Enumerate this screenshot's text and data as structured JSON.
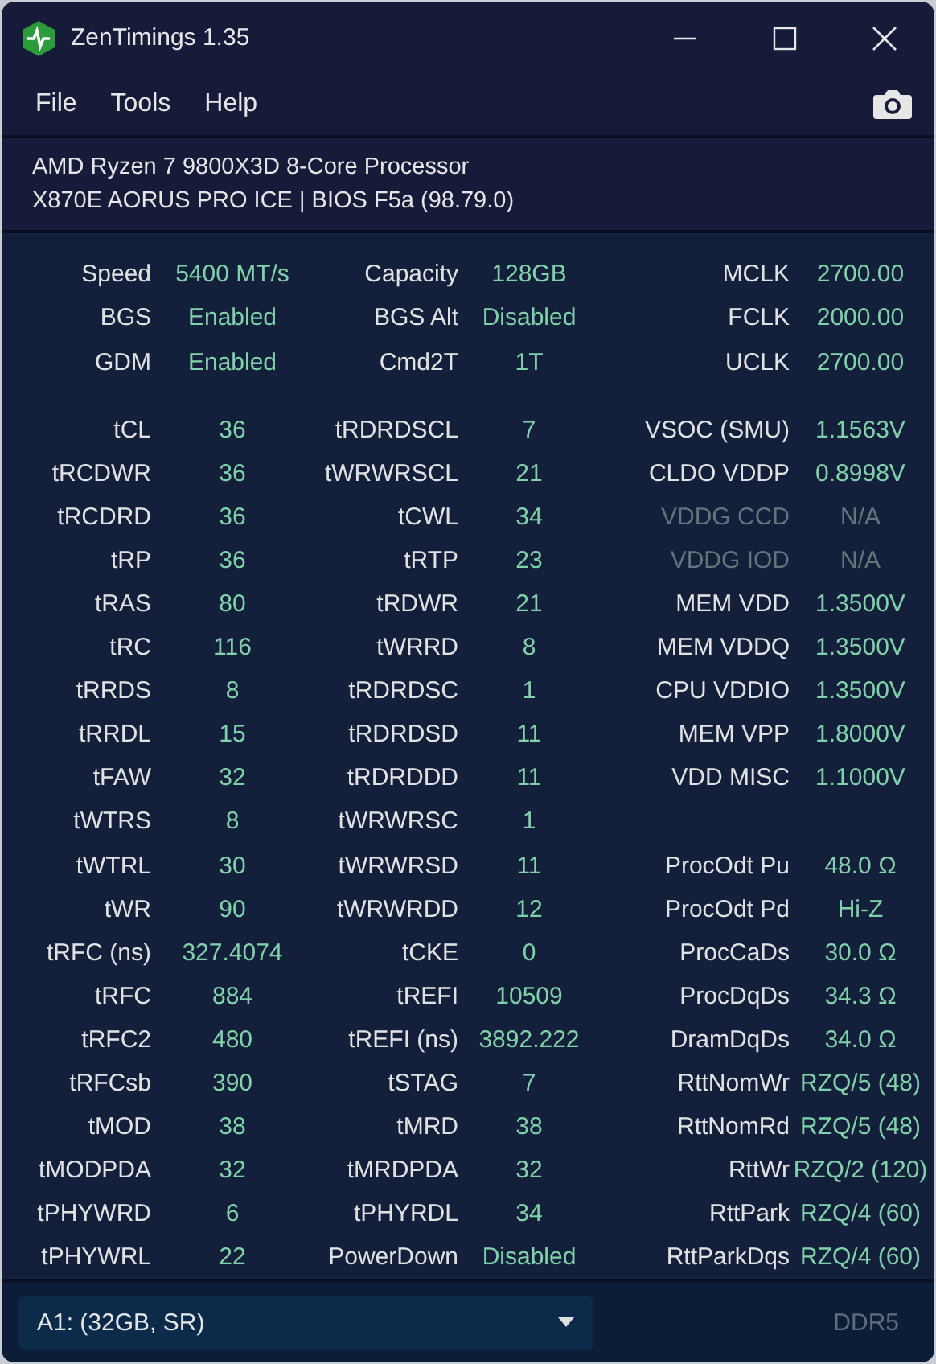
{
  "window": {
    "title": "ZenTimings 1.35"
  },
  "menu": [
    "File",
    "Tools",
    "Help"
  ],
  "system": {
    "cpu": "AMD Ryzen 7 9800X3D 8-Core Processor",
    "board": "X870E AORUS PRO ICE | BIOS F5a (98.79.0)"
  },
  "summary": [
    [
      {
        "label": "Speed",
        "value": "5400 MT/s",
        "disabled": false
      },
      {
        "label": "Capacity",
        "value": "128GB",
        "disabled": false
      },
      {
        "label": "MCLK",
        "value": "2700.00",
        "disabled": false
      }
    ],
    [
      {
        "label": "BGS",
        "value": "Enabled",
        "disabled": false
      },
      {
        "label": "BGS Alt",
        "value": "Disabled",
        "disabled": false
      },
      {
        "label": "FCLK",
        "value": "2000.00",
        "disabled": false
      }
    ],
    [
      {
        "label": "GDM",
        "value": "Enabled",
        "disabled": false
      },
      {
        "label": "Cmd2T",
        "value": "1T",
        "disabled": false
      },
      {
        "label": "UCLK",
        "value": "2700.00",
        "disabled": false
      }
    ]
  ],
  "timings": [
    [
      {
        "label": "tCL",
        "value": "36",
        "disabled": false
      },
      {
        "label": "tRDRDSCL",
        "value": "7",
        "disabled": false
      },
      {
        "label": "VSOC (SMU)",
        "value": "1.1563V",
        "disabled": false
      }
    ],
    [
      {
        "label": "tRCDWR",
        "value": "36",
        "disabled": false
      },
      {
        "label": "tWRWRSCL",
        "value": "21",
        "disabled": false
      },
      {
        "label": "CLDO VDDP",
        "value": "0.8998V",
        "disabled": false
      }
    ],
    [
      {
        "label": "tRCDRD",
        "value": "36",
        "disabled": false
      },
      {
        "label": "tCWL",
        "value": "34",
        "disabled": false
      },
      {
        "label": "VDDG CCD",
        "value": "N/A",
        "disabled": true
      }
    ],
    [
      {
        "label": "tRP",
        "value": "36",
        "disabled": false
      },
      {
        "label": "tRTP",
        "value": "23",
        "disabled": false
      },
      {
        "label": "VDDG IOD",
        "value": "N/A",
        "disabled": true
      }
    ],
    [
      {
        "label": "tRAS",
        "value": "80",
        "disabled": false
      },
      {
        "label": "tRDWR",
        "value": "21",
        "disabled": false
      },
      {
        "label": "MEM VDD",
        "value": "1.3500V",
        "disabled": false
      }
    ],
    [
      {
        "label": "tRC",
        "value": "116",
        "disabled": false
      },
      {
        "label": "tWRRD",
        "value": "8",
        "disabled": false
      },
      {
        "label": "MEM VDDQ",
        "value": "1.3500V",
        "disabled": false
      }
    ],
    [
      {
        "label": "tRRDS",
        "value": "8",
        "disabled": false
      },
      {
        "label": "tRDRDSC",
        "value": "1",
        "disabled": false
      },
      {
        "label": "CPU VDDIO",
        "value": "1.3500V",
        "disabled": false
      }
    ],
    [
      {
        "label": "tRRDL",
        "value": "15",
        "disabled": false
      },
      {
        "label": "tRDRDSD",
        "value": "11",
        "disabled": false
      },
      {
        "label": "MEM VPP",
        "value": "1.8000V",
        "disabled": false
      }
    ],
    [
      {
        "label": "tFAW",
        "value": "32",
        "disabled": false
      },
      {
        "label": "tRDRDDD",
        "value": "11",
        "disabled": false
      },
      {
        "label": "VDD MISC",
        "value": "1.1000V",
        "disabled": false
      }
    ],
    [
      {
        "label": "tWTRS",
        "value": "8",
        "disabled": false
      },
      {
        "label": "tWRWRSC",
        "value": "1",
        "disabled": false
      }
    ],
    [
      {
        "label": "tWTRL",
        "value": "30",
        "disabled": false
      },
      {
        "label": "tWRWRSD",
        "value": "11",
        "disabled": false
      },
      {
        "label": "ProcOdt Pu",
        "value": "48.0 Ω",
        "disabled": false
      }
    ],
    [
      {
        "label": "tWR",
        "value": "90",
        "disabled": false
      },
      {
        "label": "tWRWRDD",
        "value": "12",
        "disabled": false
      },
      {
        "label": "ProcOdt Pd",
        "value": "Hi-Z",
        "disabled": false
      }
    ],
    [
      {
        "label": "tRFC (ns)",
        "value": "327.4074",
        "disabled": false
      },
      {
        "label": "tCKE",
        "value": "0",
        "disabled": false
      },
      {
        "label": "ProcCaDs",
        "value": "30.0 Ω",
        "disabled": false
      }
    ],
    [
      {
        "label": "tRFC",
        "value": "884",
        "disabled": false
      },
      {
        "label": "tREFI",
        "value": "10509",
        "disabled": false
      },
      {
        "label": "ProcDqDs",
        "value": "34.3 Ω",
        "disabled": false
      }
    ],
    [
      {
        "label": "tRFC2",
        "value": "480",
        "disabled": false
      },
      {
        "label": "tREFI (ns)",
        "value": "3892.222",
        "disabled": false
      },
      {
        "label": "DramDqDs",
        "value": "34.0 Ω",
        "disabled": false
      }
    ],
    [
      {
        "label": "tRFCsb",
        "value": "390",
        "disabled": false
      },
      {
        "label": "tSTAG",
        "value": "7",
        "disabled": false
      },
      {
        "label": "RttNomWr",
        "value": "RZQ/5 (48)",
        "disabled": false
      }
    ],
    [
      {
        "label": "tMOD",
        "value": "38",
        "disabled": false
      },
      {
        "label": "tMRD",
        "value": "38",
        "disabled": false
      },
      {
        "label": "RttNomRd",
        "value": "RZQ/5 (48)",
        "disabled": false
      }
    ],
    [
      {
        "label": "tMODPDA",
        "value": "32",
        "disabled": false
      },
      {
        "label": "tMRDPDA",
        "value": "32",
        "disabled": false
      },
      {
        "label": "RttWr",
        "value": "RZQ/2 (120)",
        "disabled": false
      }
    ],
    [
      {
        "label": "tPHYWRD",
        "value": "6",
        "disabled": false
      },
      {
        "label": "tPHYRDL",
        "value": "34",
        "disabled": false
      },
      {
        "label": "RttPark",
        "value": "RZQ/4 (60)",
        "disabled": false
      }
    ],
    [
      {
        "label": "tPHYWRL",
        "value": "22",
        "disabled": false
      },
      {
        "label": "PowerDown",
        "value": "Disabled",
        "disabled": false
      },
      {
        "label": "RttParkDqs",
        "value": "RZQ/4 (60)",
        "disabled": false
      }
    ]
  ],
  "footer": {
    "module": "A1:  (32GB, SR)",
    "memory_type": "DDR5"
  }
}
